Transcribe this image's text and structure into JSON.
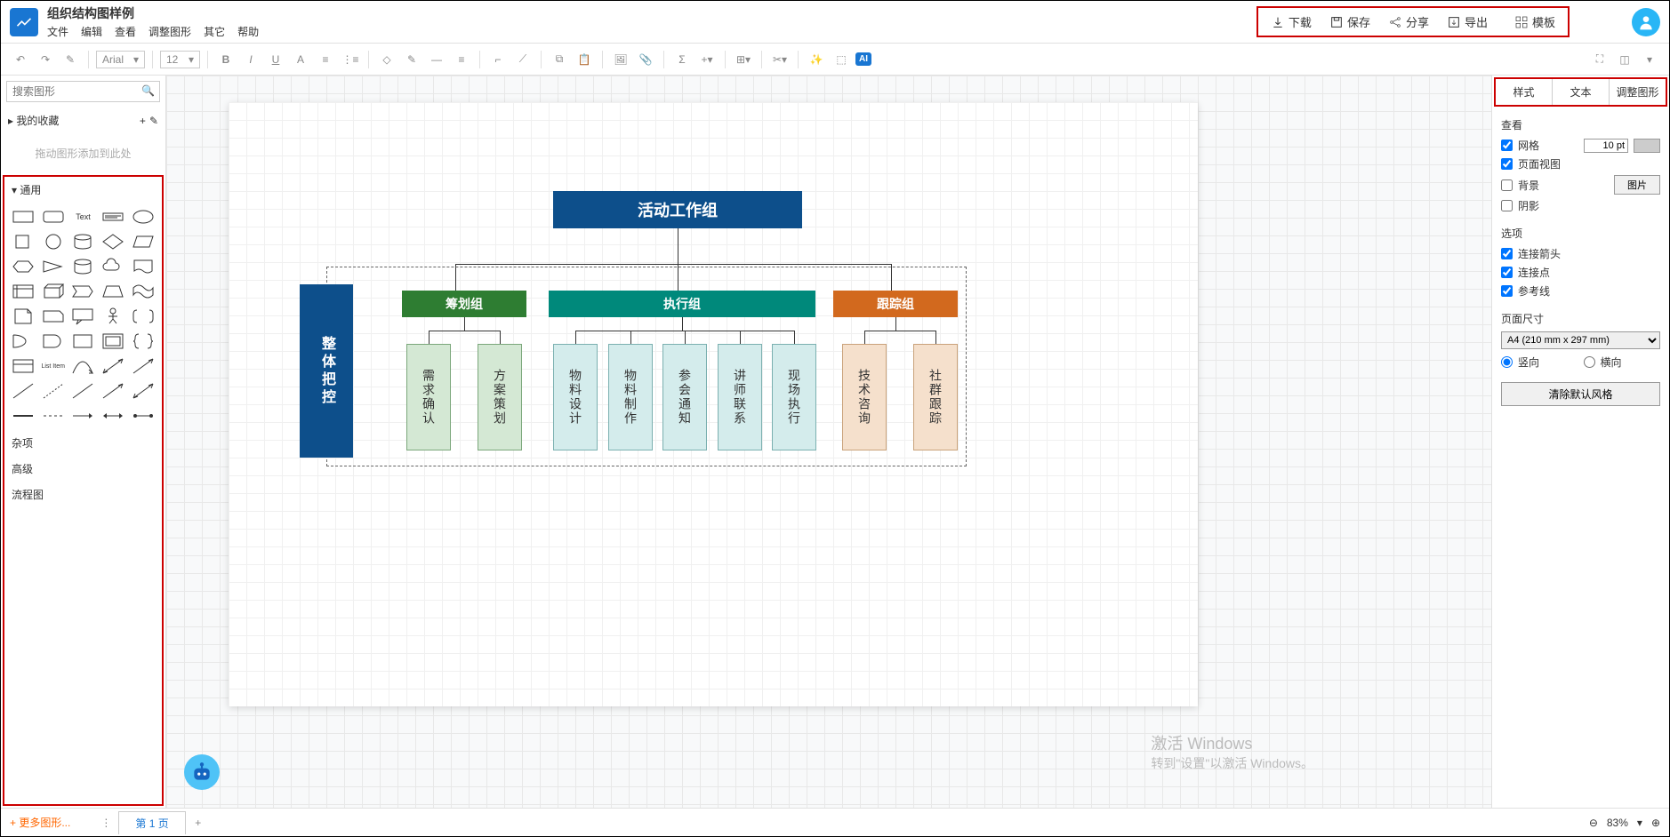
{
  "doc_title": "组织结构图样例",
  "menu": [
    "文件",
    "编辑",
    "查看",
    "调整图形",
    "其它",
    "帮助"
  ],
  "header_actions": {
    "download": "下载",
    "save": "保存",
    "share": "分享",
    "export": "导出",
    "template": "模板"
  },
  "toolbar": {
    "font": "Arial",
    "size": "12",
    "ai": "AI"
  },
  "search": {
    "placeholder": "搜索图形"
  },
  "left_panel": {
    "favorites": "我的收藏",
    "drop_hint": "拖动图形添加到此处",
    "categories": {
      "general": "通用",
      "misc": "杂项",
      "advanced": "高级",
      "flowchart": "流程图"
    },
    "text_label": "Text",
    "list_label": "List Item"
  },
  "org_chart": {
    "top": "活动工作组",
    "side": "整体把控",
    "groups": [
      {
        "label": "筹划组",
        "class": "green-node",
        "children": [
          "需求确认",
          "方案策划"
        ],
        "leaf_class": "leaf-g"
      },
      {
        "label": "执行组",
        "class": "teal-node",
        "children": [
          "物料设计",
          "物料制作",
          "参会通知",
          "讲师联系",
          "现场执行"
        ],
        "leaf_class": "leaf-t"
      },
      {
        "label": "跟踪组",
        "class": "orange-node",
        "children": [
          "技术咨询",
          "社群跟踪"
        ],
        "leaf_class": "leaf-o"
      }
    ]
  },
  "right_panel": {
    "tabs": [
      "样式",
      "文本",
      "调整图形"
    ],
    "view": {
      "title": "查看",
      "grid": "网格",
      "page_view": "页面视图",
      "background": "背景",
      "shadow": "阴影",
      "grid_size": "10 pt",
      "image_btn": "图片"
    },
    "options": {
      "title": "选项",
      "arrows": "连接箭头",
      "points": "连接点",
      "guides": "参考线"
    },
    "page_size": {
      "title": "页面尺寸",
      "value": "A4 (210 mm x 297 mm)",
      "portrait": "竖向",
      "landscape": "横向"
    },
    "clear_style": "清除默认风格"
  },
  "footer": {
    "more_shapes": "+ 更多图形...",
    "page_tab": "第 1 页",
    "zoom": "83%"
  },
  "watermark": {
    "title": "激活 Windows",
    "sub": "转到\"设置\"以激活 Windows。"
  }
}
